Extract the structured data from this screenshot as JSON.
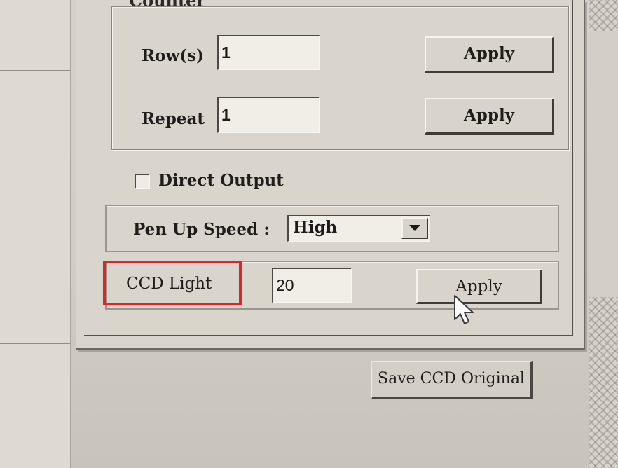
{
  "counter": {
    "legend": "Counter",
    "rows_label": "Row(s)",
    "rows_value": "1",
    "repeat_label": "Repeat",
    "repeat_value": "1",
    "apply_label": "Apply"
  },
  "direct_output": {
    "label": "Direct Output",
    "checked": false
  },
  "pen_up_speed": {
    "label": "Pen Up Speed :",
    "selected": "High"
  },
  "ccd_light": {
    "label": "CCD Light",
    "value": "20",
    "apply_label": "Apply"
  },
  "save_ccd_original": {
    "label": "Save CCD Original"
  },
  "colors": {
    "highlight_box": "#e0232b",
    "window_face": "#d9d5cd"
  }
}
